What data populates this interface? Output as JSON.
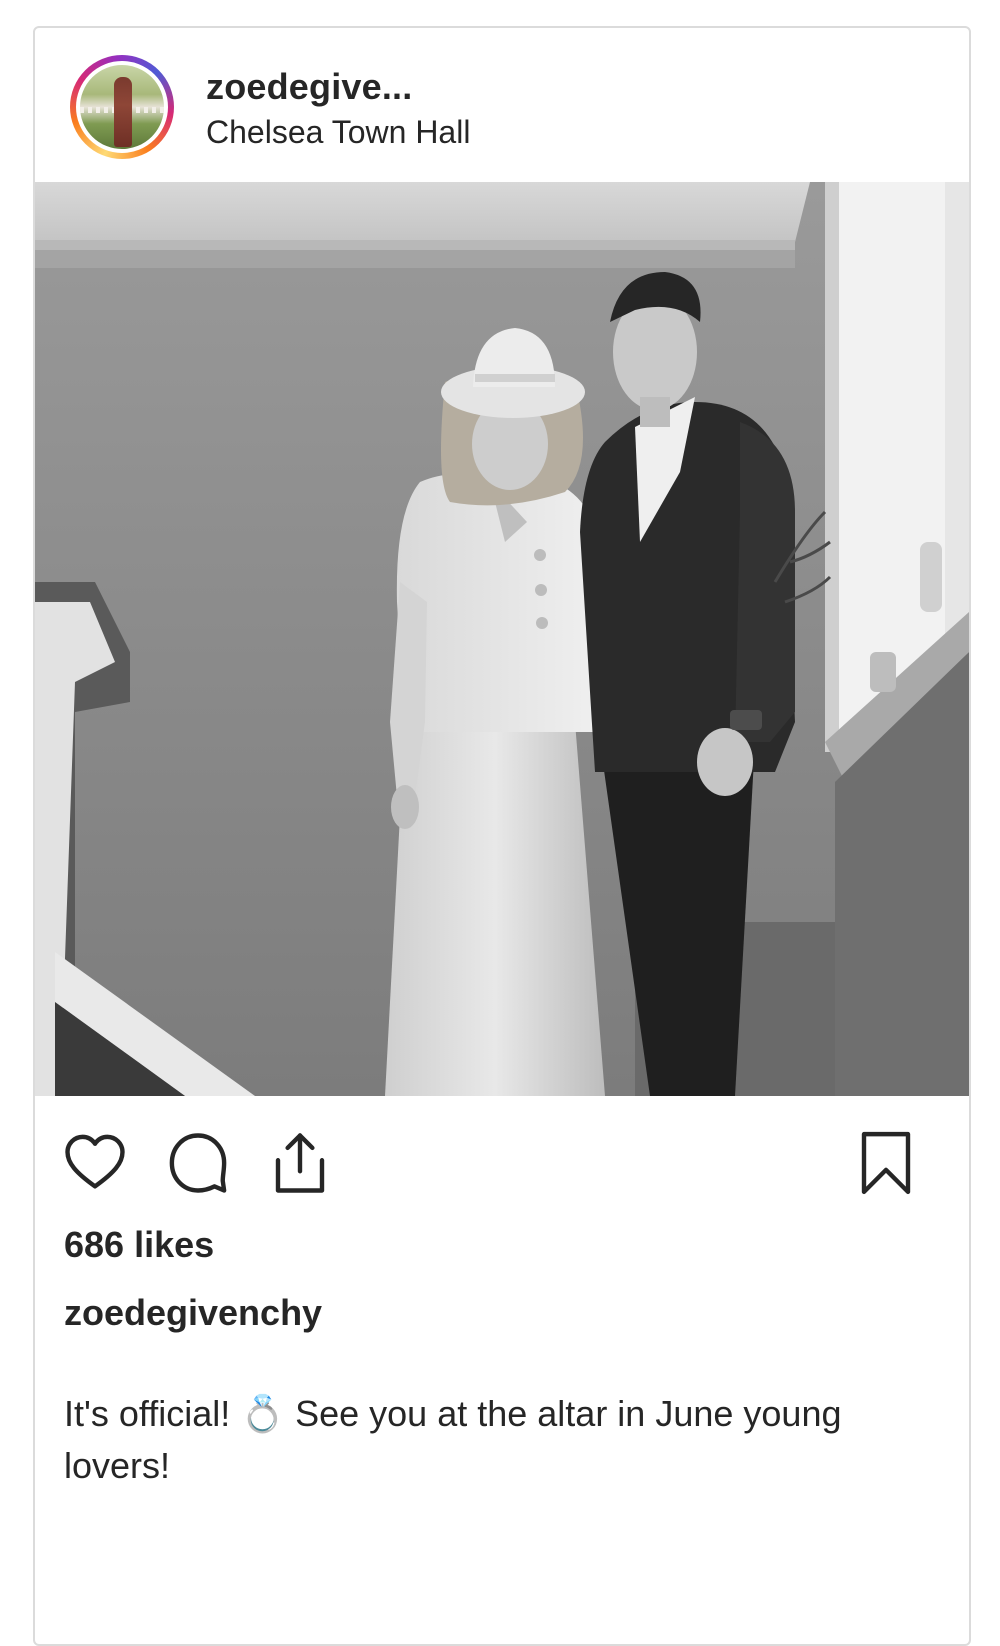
{
  "post": {
    "username_truncated": "zoedegive...",
    "location": "Chelsea Town Hall",
    "likes_text": "686 likes",
    "caption_username": "zoedegivenchy",
    "caption_text": "It's official! 💍 See you at the altar in June young lovers!"
  },
  "icons": {
    "like": "heart-icon",
    "comment": "comment-bubble-icon",
    "share": "share-upload-icon",
    "save": "bookmark-icon"
  },
  "colors": {
    "text": "#262626",
    "border": "#dbdbdb",
    "story_ring_start": "#feda75",
    "story_ring_mid": "#d62976",
    "story_ring_end": "#4f5bd5"
  }
}
